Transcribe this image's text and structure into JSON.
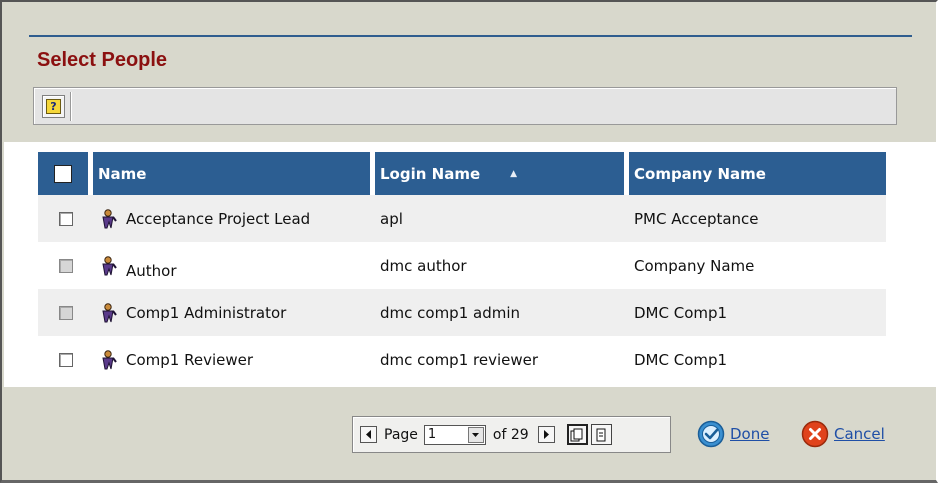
{
  "dialog": {
    "title": "Select People"
  },
  "toolbar": {
    "help_icon_name": "help-icon",
    "help_glyph": "?"
  },
  "table": {
    "columns": [
      {
        "label": "",
        "type": "select-all"
      },
      {
        "label": "Name"
      },
      {
        "label": "Login Name",
        "sort": "ascending"
      },
      {
        "label": "Company Name"
      }
    ],
    "rows": [
      {
        "name": "Acceptance Project Lead",
        "login": "apl",
        "company": "PMC Acceptance",
        "checkbox": "enabled"
      },
      {
        "name": "Author",
        "login": "dmc author",
        "company": "Company Name",
        "checkbox": "disabled"
      },
      {
        "name": "Comp1 Administrator",
        "login": "dmc comp1 admin",
        "company": "DMC Comp1",
        "checkbox": "disabled"
      },
      {
        "name": "Comp1 Reviewer",
        "login": "dmc comp1 reviewer",
        "company": "DMC Comp1",
        "checkbox": "enabled"
      }
    ]
  },
  "pager": {
    "page_label": "Page",
    "current_page": "1",
    "of_label": "of 29"
  },
  "actions": {
    "done_label": "Done",
    "cancel_label": "Cancel"
  },
  "colors": {
    "header_bg": "#2c5e92",
    "title": "#8b1010",
    "link": "#1f4fa6",
    "done_icon": "#3a8fd0",
    "cancel_icon": "#e0431c"
  }
}
